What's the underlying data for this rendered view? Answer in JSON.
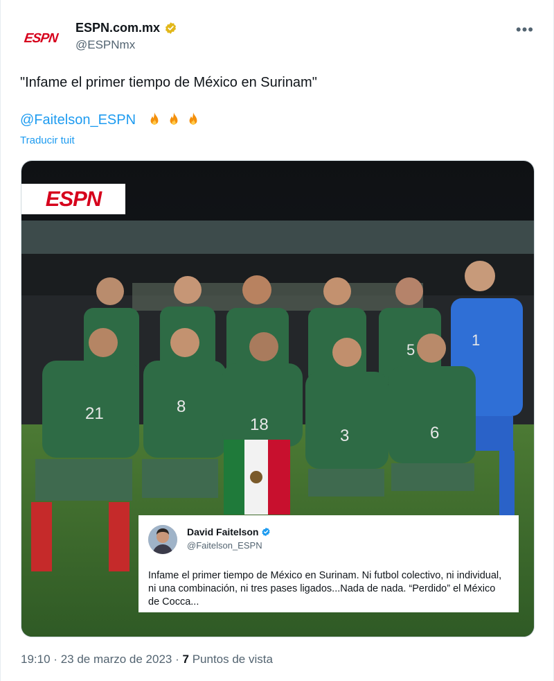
{
  "tweet": {
    "avatar_logo": "ESPN",
    "display_name": "ESPN.com.mx",
    "handle": "@ESPNmx",
    "more_icon": "more-icon",
    "text": "\"Infame el primer tiempo de México en Surinam\"",
    "mention": "@Faitelson_ESPN",
    "emojis": [
      "fire-icon",
      "fire-icon",
      "fire-icon"
    ],
    "translate_label": "Traducir tuit"
  },
  "media": {
    "banner_logo": "ESPN",
    "players_front": [
      "21",
      "8",
      "18",
      "3",
      "6"
    ],
    "players_back": [
      "5",
      "1"
    ],
    "quoted": {
      "name": "David Faitelson",
      "handle": "@Faitelson_ESPN",
      "text": "Infame el primer tiempo de México en Surinam. Ni futbol colectivo, ni individual, ni una combinación, ni tres pases ligados...Nada de nada. “Perdido” el México de Cocca..."
    }
  },
  "meta": {
    "time": "19:10",
    "sep1": "·",
    "date": "23 de marzo de 2023",
    "sep2": "·",
    "views_count": "7",
    "views_label": "Puntos de vista"
  },
  "colors": {
    "accent": "#1d9bf0",
    "brand": "#d6001c",
    "kit": "#2e6b45"
  }
}
